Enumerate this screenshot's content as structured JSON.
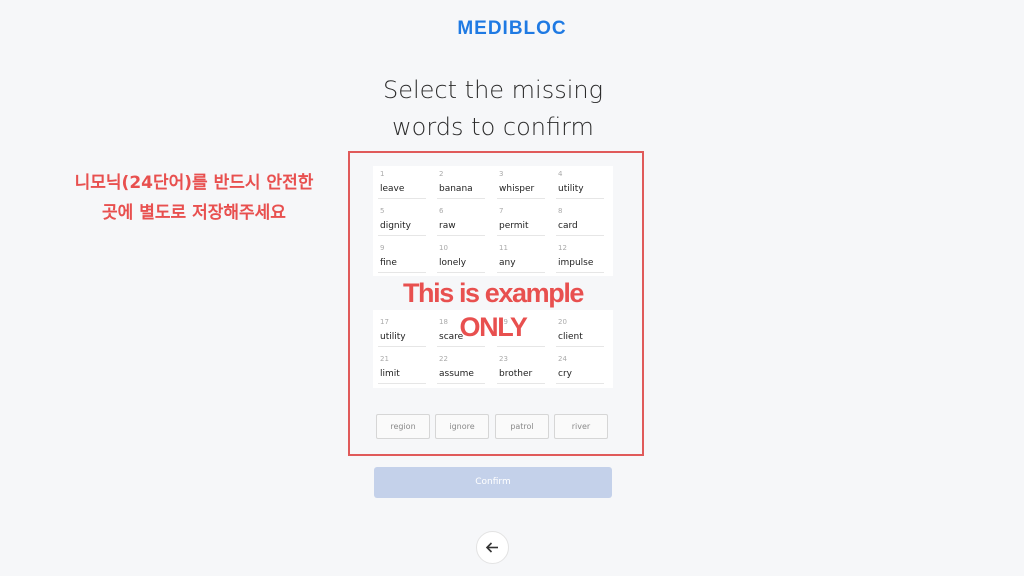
{
  "brand": {
    "logo_text": "MEDIBLOC"
  },
  "heading": {
    "line1": "Select the missing",
    "line2": "words to confirm"
  },
  "annotation": {
    "line1": "니모닉(24단어)를 반드시 안전한",
    "line2": "곳에 별도로 저장해주세요"
  },
  "watermark": "This is example ONLY",
  "words": [
    {
      "n": "1",
      "w": "leave"
    },
    {
      "n": "2",
      "w": "banana"
    },
    {
      "n": "3",
      "w": "whisper"
    },
    {
      "n": "4",
      "w": "utility"
    },
    {
      "n": "5",
      "w": "dignity"
    },
    {
      "n": "6",
      "w": "raw"
    },
    {
      "n": "7",
      "w": "permit"
    },
    {
      "n": "8",
      "w": "card"
    },
    {
      "n": "9",
      "w": "fine"
    },
    {
      "n": "10",
      "w": "lonely"
    },
    {
      "n": "11",
      "w": "any"
    },
    {
      "n": "12",
      "w": "impulse"
    },
    {
      "n": "17",
      "w": "utility"
    },
    {
      "n": "18",
      "w": "scare"
    },
    {
      "n": "19",
      "w": ""
    },
    {
      "n": "20",
      "w": "client"
    },
    {
      "n": "21",
      "w": "limit"
    },
    {
      "n": "22",
      "w": "assume"
    },
    {
      "n": "23",
      "w": "brother"
    },
    {
      "n": "24",
      "w": "cry"
    }
  ],
  "options": [
    "region",
    "ignore",
    "patrol",
    "river"
  ],
  "confirm_label": "Confirm",
  "icons": {
    "back": "arrow-left-icon"
  },
  "colors": {
    "brand": "#1f7ae3",
    "annotation": "#e8504f",
    "confirm_disabled": "#c4d1ea"
  }
}
